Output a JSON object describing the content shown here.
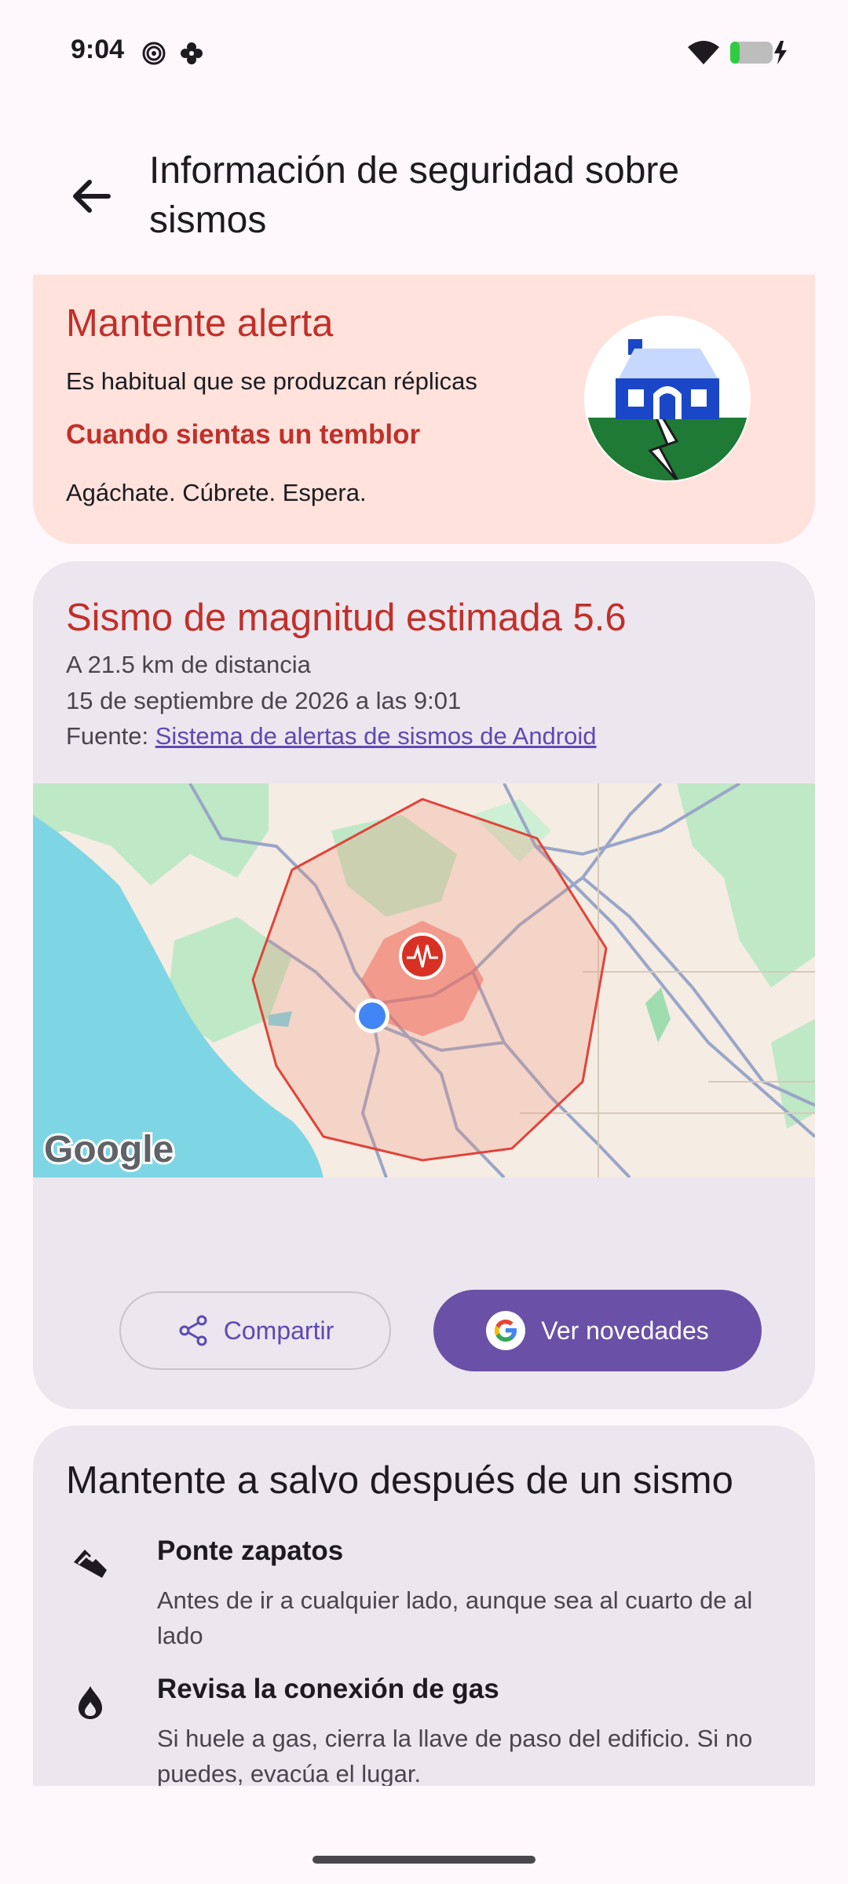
{
  "status_bar": {
    "time": "9:04",
    "icons": [
      "spiral-icon",
      "pinwheel-icon",
      "wifi-icon",
      "battery-charging-icon"
    ]
  },
  "app_bar": {
    "back_icon": "arrow-back-icon",
    "title": "Información de seguridad sobre sismos"
  },
  "alert_card": {
    "title": "Mantente alerta",
    "subtitle": "Es habitual que se produzcan réplicas",
    "heading": "Cuando sientas un temblor",
    "body": "Agáchate. Cúbrete. Espera.",
    "illustration": "house-earthquake-icon"
  },
  "quake_card": {
    "title": "Sismo de magnitud estimada 5.6",
    "distance": "A 21.5 km de distancia",
    "datetime": "15 de septiembre de 2026 a las 9:01",
    "source_label": "Fuente: ",
    "source_link": "Sistema de alertas de sismos de Android",
    "map": {
      "logo_text": "Google",
      "epicenter_icon": "seismic-wave-icon",
      "user_location_icon": "location-dot-icon"
    },
    "share_button": {
      "label": "Compartir",
      "icon": "share-icon"
    },
    "news_button": {
      "label": "Ver novedades",
      "icon": "google-g-icon"
    }
  },
  "safety_card": {
    "title": "Mantente a salvo después de un sismo",
    "items": [
      {
        "icon": "shoe-icon",
        "title": "Ponte zapatos",
        "body": "Antes de ir a cualquier lado, aunque sea al cuarto de al lado"
      },
      {
        "icon": "gas-flame-icon",
        "title": "Revisa la conexión de gas",
        "body": "Si huele a gas, cierra la llave de paso del edificio. Si no puedes, evacúa el lugar."
      }
    ]
  },
  "colors": {
    "accent_red": "#C0302A",
    "primary_purple": "#6A50A7",
    "alert_bg": "#FFE2DC",
    "card_bg": "#ECE6EE"
  }
}
